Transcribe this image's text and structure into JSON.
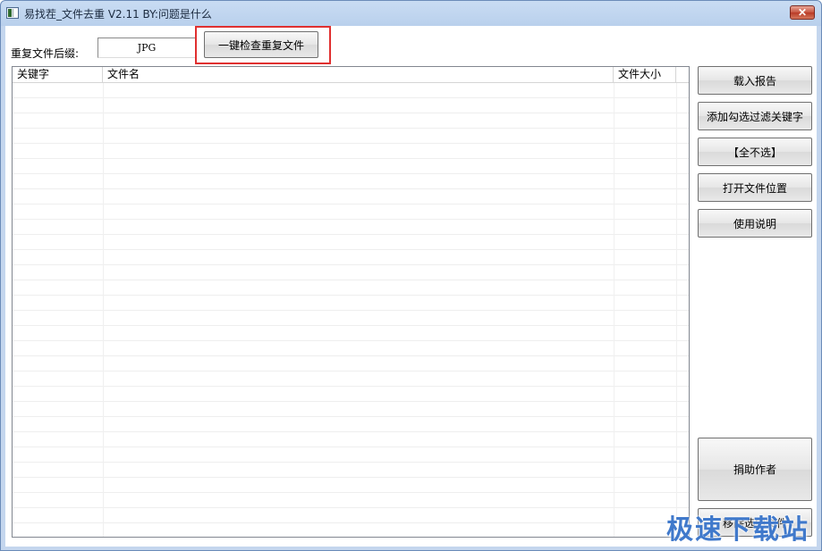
{
  "window": {
    "title": "易找茬_文件去重 V2.11  BY:问题是什么",
    "close_label": "✕"
  },
  "toolbar": {
    "suffix_label": "重复文件后缀:",
    "suffix_value": "JPG",
    "check_button": "一键检查重复文件"
  },
  "list": {
    "columns": [
      "关键字",
      "文件名",
      "文件大小"
    ]
  },
  "side_buttons": {
    "load_report": "载入报告",
    "add_filter": "添加勾选过滤关键字",
    "select_none": "【全不选】",
    "open_location": "打开文件位置",
    "instructions": "使用说明",
    "donate": "捐助作者",
    "remove": "移除选中文件"
  },
  "watermark": "极速下载站",
  "colors": {
    "highlight": "#e03030",
    "watermark": "#2667c4"
  }
}
